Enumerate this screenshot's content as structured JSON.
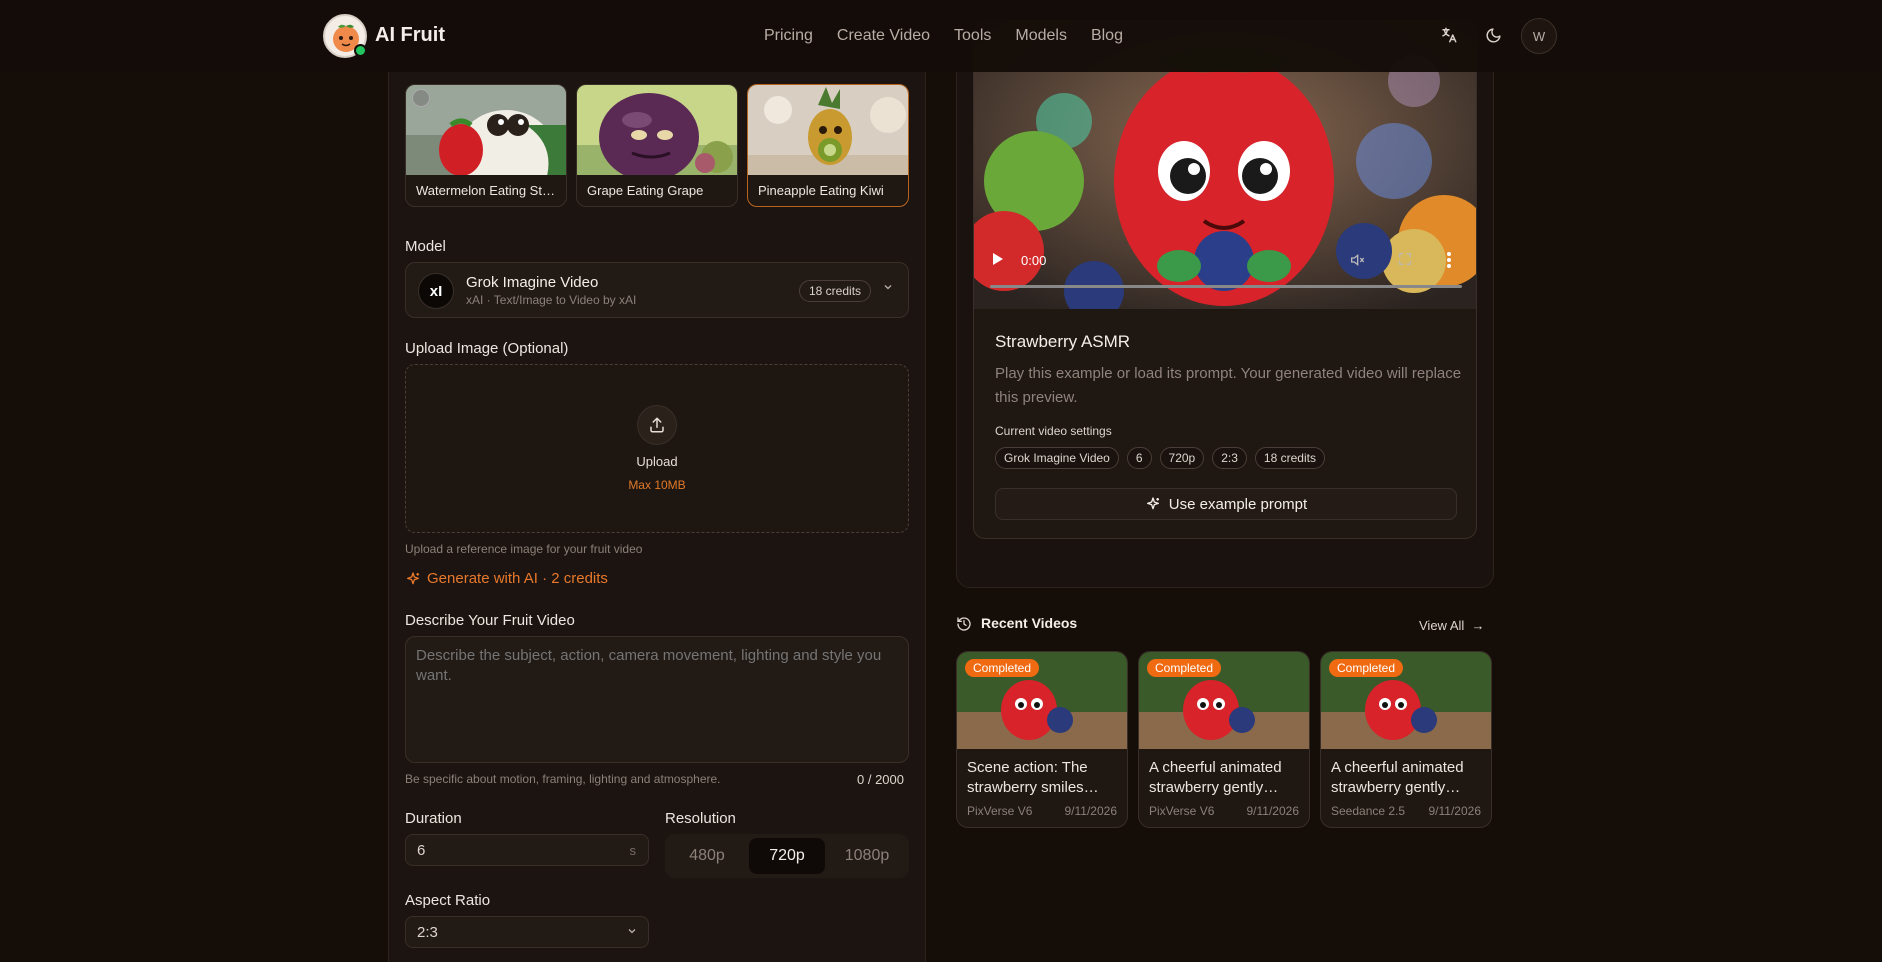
{
  "header": {
    "brand": "AI Fruit",
    "nav": [
      "Pricing",
      "Create Video",
      "Tools",
      "Models",
      "Blog"
    ],
    "avatar_initial": "W"
  },
  "examples": [
    {
      "label": "Watermelon Eating Strawberry"
    },
    {
      "label": "Grape Eating Grape"
    },
    {
      "label": "Pineapple Eating Kiwi"
    }
  ],
  "model": {
    "section_label": "Model",
    "logo_text": "xI",
    "name": "Grok Imagine Video",
    "subtitle": "xAI · Text/Image to Video by xAI",
    "credits": "18 credits"
  },
  "upload": {
    "section_label": "Upload Image (Optional)",
    "button_text": "Upload",
    "max_size": "Max 10MB",
    "hint": "Upload a reference image for your fruit video"
  },
  "generate_ai": "Generate with AI · 2 credits",
  "describe": {
    "section_label": "Describe Your Fruit Video",
    "placeholder": "Describe the subject, action, camera movement, lighting and style you want.",
    "hint": "Be specific about motion, framing, lighting and atmosphere.",
    "counter": "0 / 2000"
  },
  "duration": {
    "label": "Duration",
    "value": "6",
    "unit": "s"
  },
  "resolution": {
    "label": "Resolution",
    "options": [
      "480p",
      "720p",
      "1080p"
    ],
    "selected": "720p"
  },
  "aspect": {
    "label": "Aspect Ratio",
    "value": "2:3"
  },
  "preview": {
    "time": "0:00",
    "title": "Strawberry ASMR",
    "description": "Play this example or load its prompt. Your generated video will replace this preview.",
    "settings_label": "Current video settings",
    "chips": [
      "Grok Imagine Video",
      "6",
      "720p",
      "2:3",
      "18 credits"
    ],
    "use_button": "Use example prompt"
  },
  "recent": {
    "title": "Recent Videos",
    "view_all": "View All",
    "items": [
      {
        "status": "Completed",
        "text": "Scene action: The strawberry smiles…",
        "model": "PixVerse V6",
        "date": "9/11/2026"
      },
      {
        "status": "Completed",
        "text": "A cheerful animated strawberry gently…",
        "model": "PixVerse V6",
        "date": "9/11/2026"
      },
      {
        "status": "Completed",
        "text": "A cheerful animated strawberry gently…",
        "model": "Seedance 2.5",
        "date": "9/11/2026"
      }
    ]
  },
  "colors": {
    "accent": "#e8782b",
    "badge": "#f06a12",
    "online": "#22c55e"
  }
}
